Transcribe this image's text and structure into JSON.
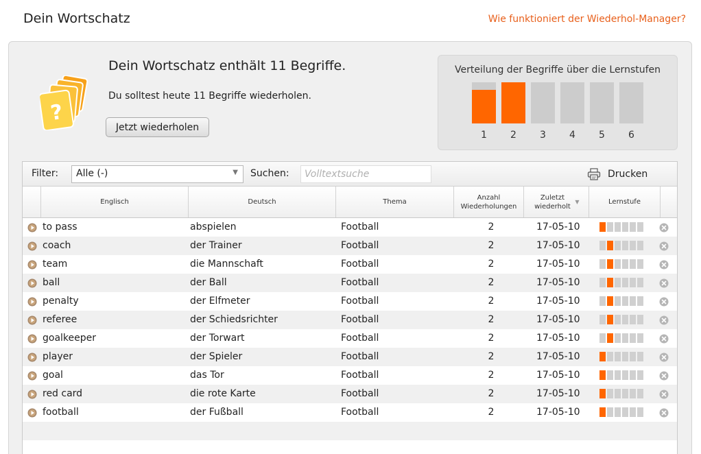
{
  "header": {
    "title": "Dein Wortschatz",
    "help_link": "Wie funktioniert der Wiederhol-Manager?"
  },
  "summary": {
    "heading": "Dein Wortschatz enthält 11 Begriffe.",
    "subtext": "Du solltest heute 11 Begriffe wiederholen.",
    "review_button": "Jetzt wiederholen",
    "icon": "question-cards-icon"
  },
  "distribution": {
    "title": "Verteilung der Begriffe über die Lernstufen",
    "levels": [
      {
        "label": "1",
        "fill": 0.82
      },
      {
        "label": "2",
        "fill": 1.0
      },
      {
        "label": "3",
        "fill": 0
      },
      {
        "label": "4",
        "fill": 0
      },
      {
        "label": "5",
        "fill": 0
      },
      {
        "label": "6",
        "fill": 0
      }
    ]
  },
  "toolbar": {
    "filter_label": "Filter:",
    "filter_value": "Alle (-)",
    "search_label": "Suchen:",
    "search_placeholder": "Volltextsuche",
    "print_label": "Drucken"
  },
  "table": {
    "columns": {
      "english": "Englisch",
      "german": "Deutsch",
      "topic": "Thema",
      "count": "Anzahl Wiederholungen",
      "last": "Zuletzt wiederholt",
      "level": "Lernstufe"
    },
    "rows": [
      {
        "english": "to pass",
        "german": "abspielen",
        "topic": "Football",
        "count": "2",
        "last": "17-05-10",
        "level": 1
      },
      {
        "english": "coach",
        "german": "der Trainer",
        "topic": "Football",
        "count": "2",
        "last": "17-05-10",
        "level": 2
      },
      {
        "english": "team",
        "german": "die Mannschaft",
        "topic": "Football",
        "count": "2",
        "last": "17-05-10",
        "level": 2
      },
      {
        "english": "ball",
        "german": "der Ball",
        "topic": "Football",
        "count": "2",
        "last": "17-05-10",
        "level": 2
      },
      {
        "english": "penalty",
        "german": "der Elfmeter",
        "topic": "Football",
        "count": "2",
        "last": "17-05-10",
        "level": 2
      },
      {
        "english": "referee",
        "german": "der Schiedsrichter",
        "topic": "Football",
        "count": "2",
        "last": "17-05-10",
        "level": 2
      },
      {
        "english": "goalkeeper",
        "german": "der Torwart",
        "topic": "Football",
        "count": "2",
        "last": "17-05-10",
        "level": 2
      },
      {
        "english": "player",
        "german": "der Spieler",
        "topic": "Football",
        "count": "2",
        "last": "17-05-10",
        "level": 1
      },
      {
        "english": "goal",
        "german": "das Tor",
        "topic": "Football",
        "count": "2",
        "last": "17-05-10",
        "level": 1
      },
      {
        "english": "red card",
        "german": "die rote Karte",
        "topic": "Football",
        "count": "2",
        "last": "17-05-10",
        "level": 1
      },
      {
        "english": "football",
        "german": "der Fußball",
        "topic": "Football",
        "count": "2",
        "last": "17-05-10",
        "level": 1
      }
    ],
    "max_level": 6
  },
  "colors": {
    "accent": "#ff6600",
    "link": "#e8601c",
    "inactive": "#cccccc"
  }
}
